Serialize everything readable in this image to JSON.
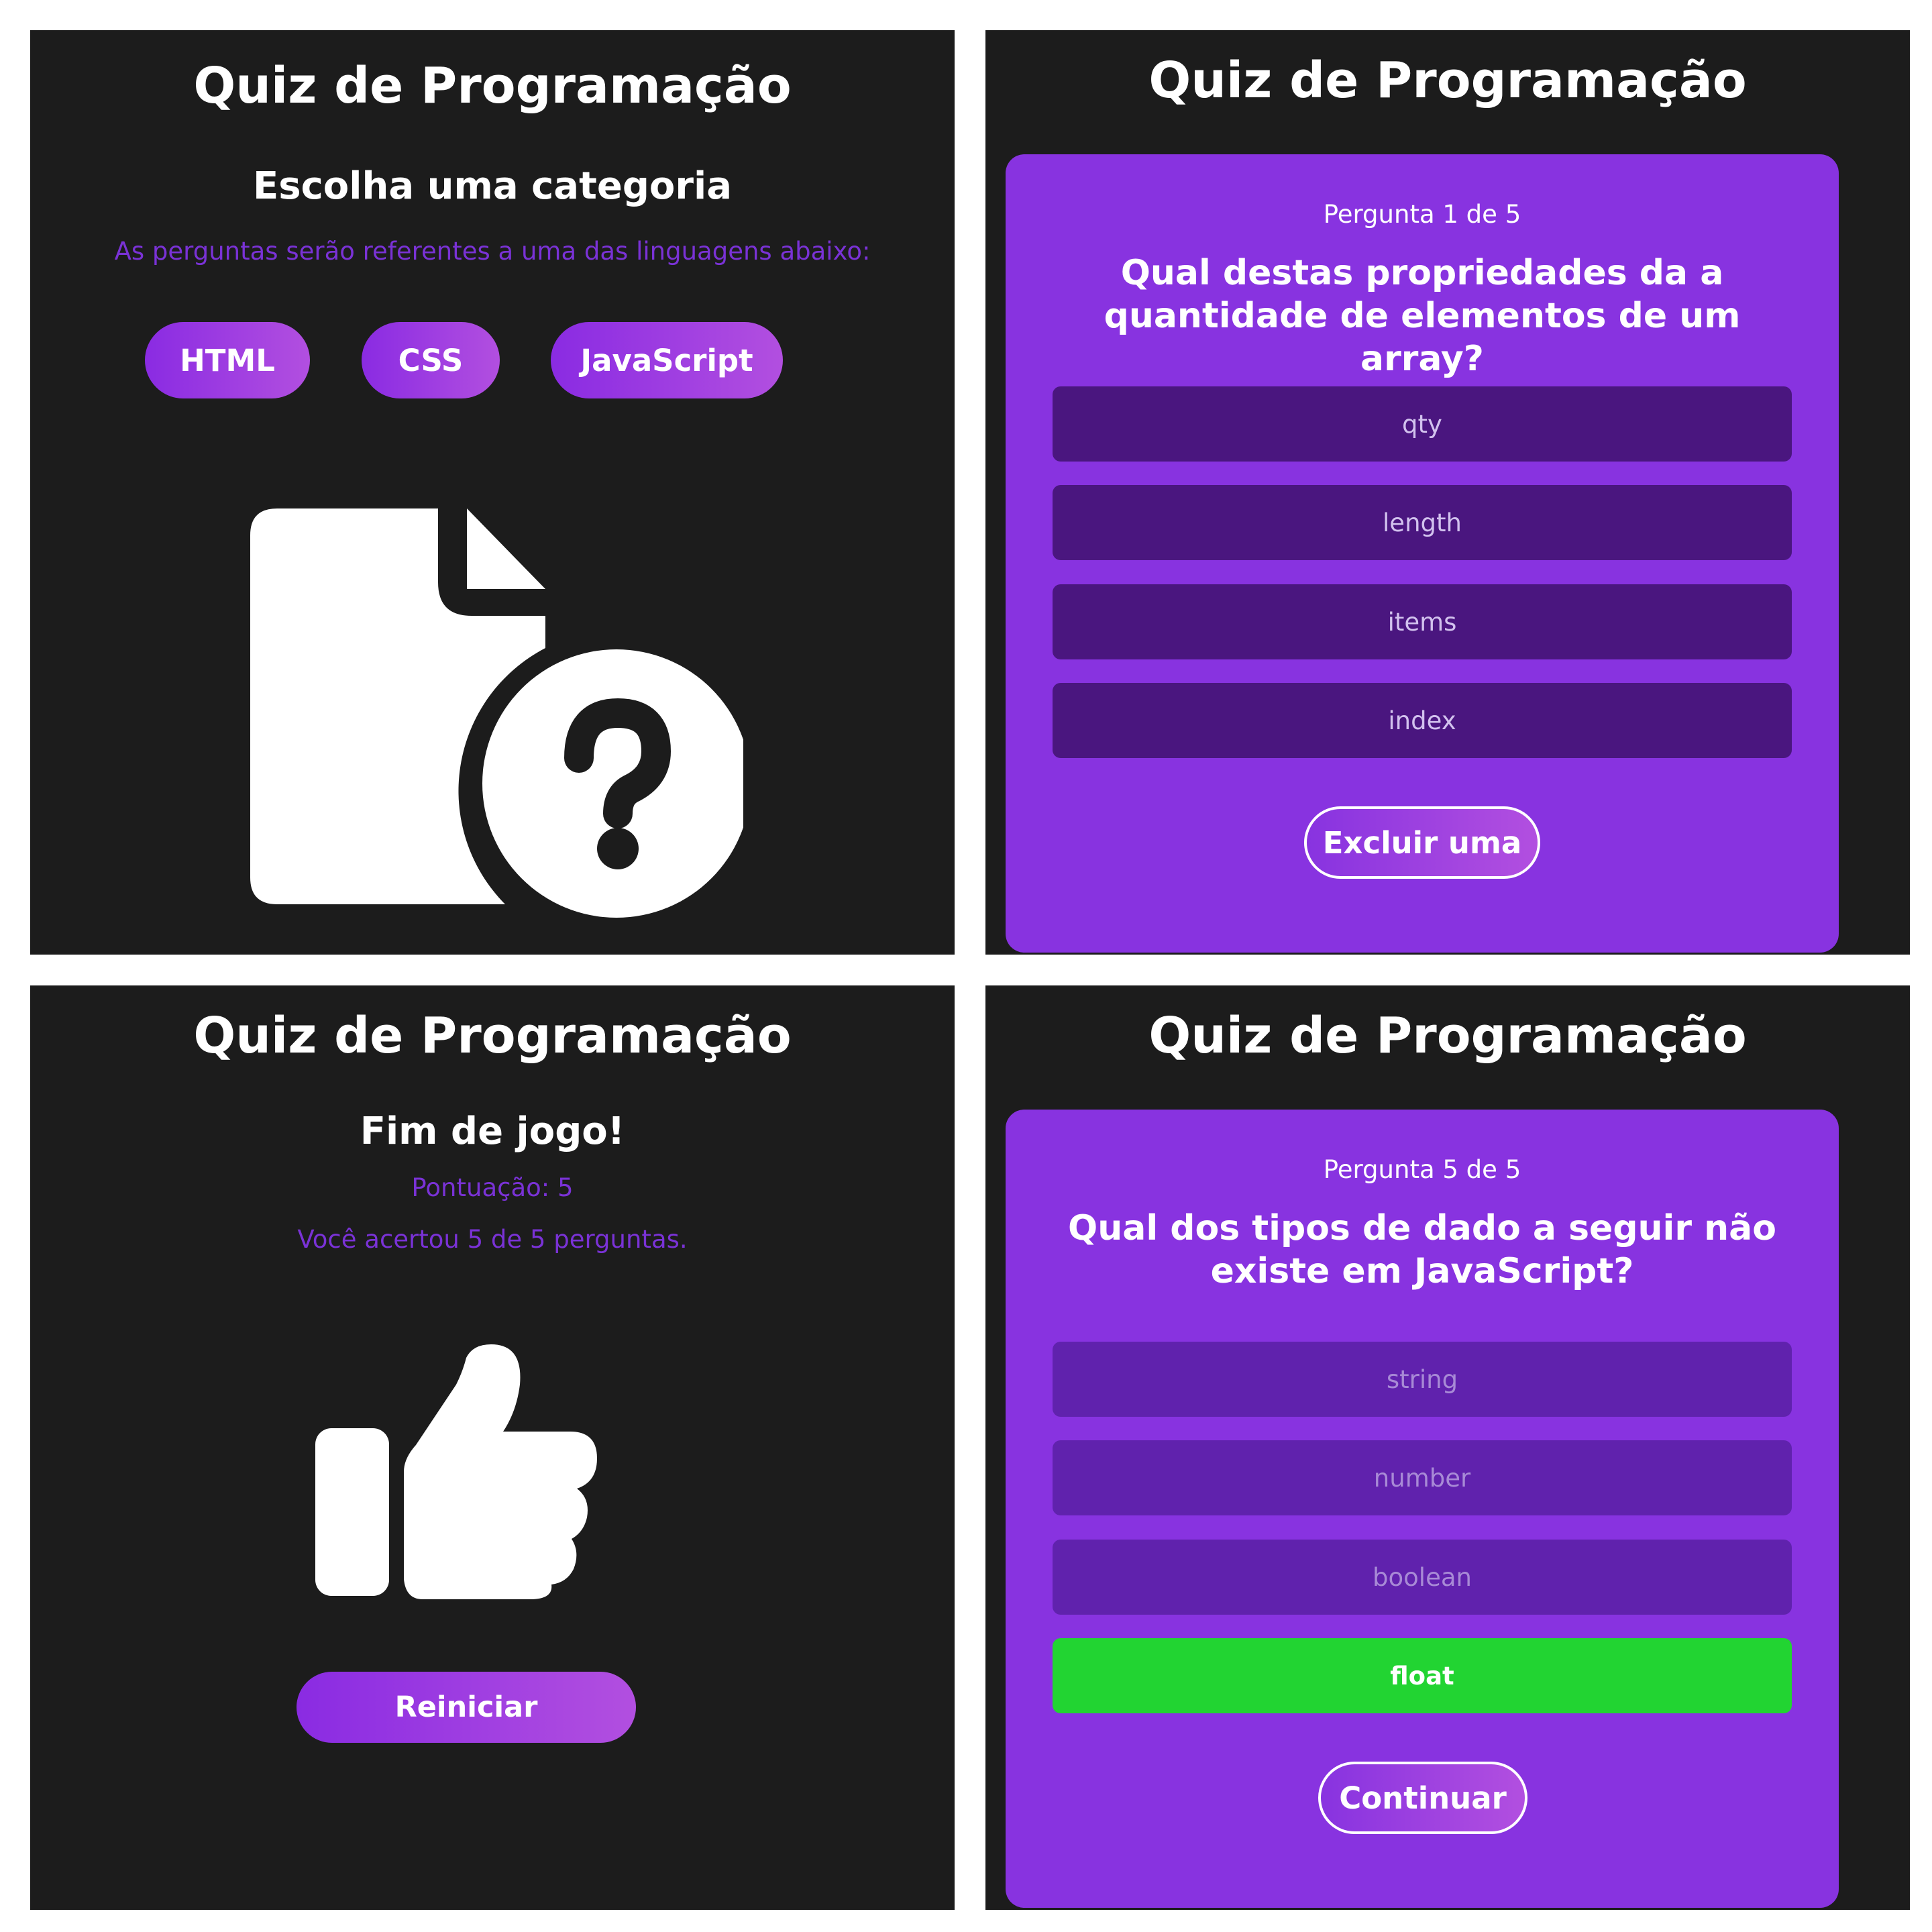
{
  "colors": {
    "panel_bg": "#1c1c1c",
    "card_bg": "#8833e0",
    "answer_bg": "#4a167f",
    "answer_disabled_bg": "#6022ad",
    "correct_bg": "#22d432",
    "accent_text": "#7a32d6"
  },
  "screen_category": {
    "title": "Quiz de Programação",
    "heading": "Escolha uma categoria",
    "description": "As perguntas serão referentes a uma das linguagens abaixo:",
    "categories": [
      "HTML",
      "CSS",
      "JavaScript"
    ],
    "illustration_icon": "file-question-icon"
  },
  "screen_question_1": {
    "title": "Quiz de Programação",
    "counter": "Pergunta 1 de 5",
    "question": "Qual destas propriedades da a quantidade de elementos de um array?",
    "answers": [
      "qty",
      "length",
      "items",
      "index"
    ],
    "action_label": "Excluir uma"
  },
  "screen_end": {
    "title": "Quiz de Programação",
    "heading": "Fim de jogo!",
    "score": "Pontuação: 5",
    "summary": "Você acertou 5 de 5 perguntas.",
    "illustration_icon": "thumbs-up-icon",
    "restart_label": "Reiniciar"
  },
  "screen_question_5": {
    "title": "Quiz de Programação",
    "counter": "Pergunta 5 de 5",
    "question": "Qual dos tipos de dado a seguir não existe em JavaScript?",
    "answers": [
      "string",
      "number",
      "boolean",
      "float"
    ],
    "correct_answer": "float",
    "action_label": "Continuar"
  }
}
